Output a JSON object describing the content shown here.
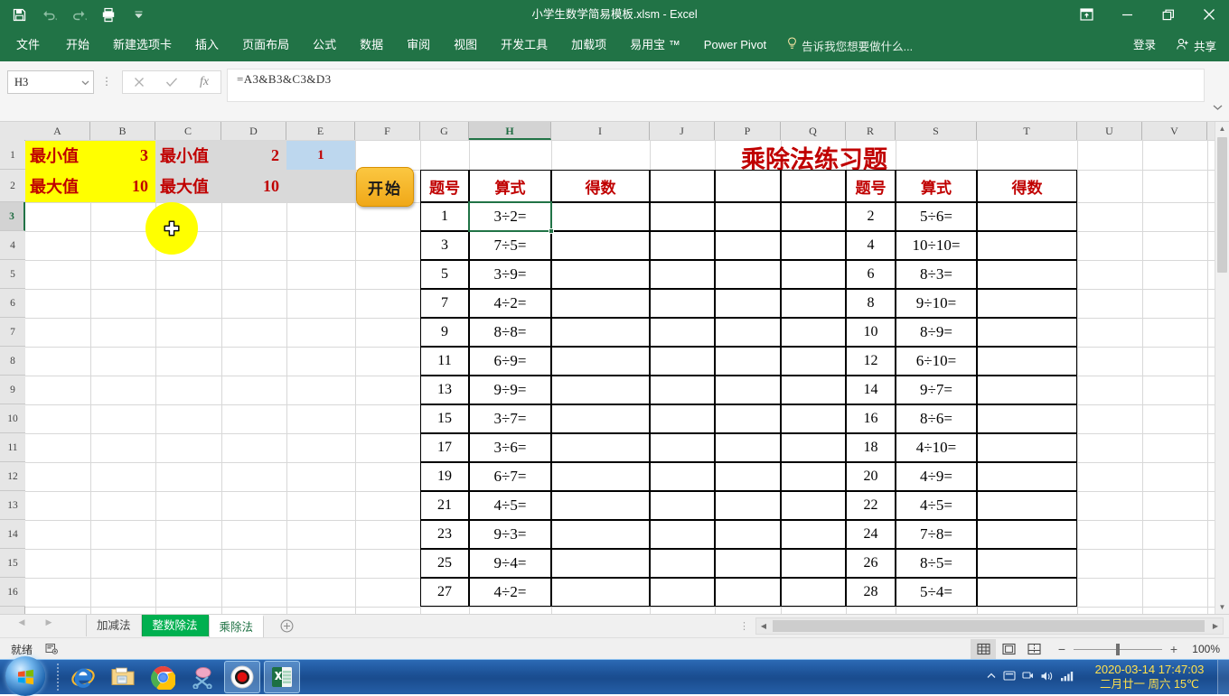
{
  "titlebar": {
    "document_title": "小学生数学简易模板.xlsm - Excel",
    "quick_access": [
      {
        "name": "save-icon",
        "label": "保存"
      },
      {
        "name": "undo-icon",
        "label": "撤销"
      },
      {
        "name": "redo-icon",
        "label": "恢复"
      },
      {
        "name": "print-preview-icon",
        "label": "打印预览和打印"
      },
      {
        "name": "customize-qat-icon",
        "label": "自定义快速访问工具栏"
      }
    ],
    "window_buttons": [
      {
        "name": "ribbon-display-options-icon",
        "label": "功能区显示选项"
      },
      {
        "name": "minimize-icon",
        "label": "最小化"
      },
      {
        "name": "restore-icon",
        "label": "向下还原"
      },
      {
        "name": "close-icon",
        "label": "关闭"
      }
    ]
  },
  "ribbon": {
    "tabs": [
      "文件",
      "开始",
      "新建选项卡",
      "插入",
      "页面布局",
      "公式",
      "数据",
      "审阅",
      "视图",
      "开发工具",
      "加载项",
      "易用宝 ™",
      "Power Pivot"
    ],
    "tell_me": "告诉我您想要做什么...",
    "sign_in": "登录",
    "share": "共享"
  },
  "formula_bar": {
    "name_box": "H3",
    "cancel_label": "取消",
    "enter_label": "输入",
    "function_label": "插入函数",
    "formula": "=A3&B3&C3&D3",
    "placeholder": ""
  },
  "grid": {
    "columns": [
      "A",
      "B",
      "C",
      "D",
      "E",
      "F",
      "G",
      "H",
      "I",
      "J",
      "P",
      "Q",
      "R",
      "S",
      "T",
      "U",
      "V"
    ],
    "selected_column": "H",
    "rows": [
      "1",
      "2",
      "3",
      "4",
      "5",
      "6",
      "7",
      "8",
      "9",
      "10",
      "11",
      "12",
      "13",
      "14",
      "15",
      "16"
    ],
    "selected_row": "3",
    "selected_cell": "H3",
    "params": [
      {
        "label": "最小值",
        "value": "3",
        "label2": "最小值",
        "value2": "2"
      },
      {
        "label": "最大值",
        "value": "10",
        "label2": "最大值",
        "value2": "10"
      }
    ],
    "counter_cell": "1",
    "start_button": "开始",
    "worksheet_title": "乘除法练习题",
    "table_headers": [
      "题号",
      "算式",
      "得数"
    ],
    "left_table": [
      {
        "no": "1",
        "expr": "3÷2=",
        "result": ""
      },
      {
        "no": "3",
        "expr": "7÷5=",
        "result": ""
      },
      {
        "no": "5",
        "expr": "3÷9=",
        "result": ""
      },
      {
        "no": "7",
        "expr": "4÷2=",
        "result": ""
      },
      {
        "no": "9",
        "expr": "8÷8=",
        "result": ""
      },
      {
        "no": "11",
        "expr": "6÷9=",
        "result": ""
      },
      {
        "no": "13",
        "expr": "9÷9=",
        "result": ""
      },
      {
        "no": "15",
        "expr": "3÷7=",
        "result": ""
      },
      {
        "no": "17",
        "expr": "3÷6=",
        "result": ""
      },
      {
        "no": "19",
        "expr": "6÷7=",
        "result": ""
      },
      {
        "no": "21",
        "expr": "4÷5=",
        "result": ""
      },
      {
        "no": "23",
        "expr": "9÷3=",
        "result": ""
      },
      {
        "no": "25",
        "expr": "9÷4=",
        "result": ""
      },
      {
        "no": "27",
        "expr": "4÷2=",
        "result": ""
      }
    ],
    "right_table": [
      {
        "no": "2",
        "expr": "5÷6=",
        "result": ""
      },
      {
        "no": "4",
        "expr": "10÷10=",
        "result": ""
      },
      {
        "no": "6",
        "expr": "8÷3=",
        "result": ""
      },
      {
        "no": "8",
        "expr": "9÷10=",
        "result": ""
      },
      {
        "no": "10",
        "expr": "8÷9=",
        "result": ""
      },
      {
        "no": "12",
        "expr": "6÷10=",
        "result": ""
      },
      {
        "no": "14",
        "expr": "9÷7=",
        "result": ""
      },
      {
        "no": "16",
        "expr": "8÷6=",
        "result": ""
      },
      {
        "no": "18",
        "expr": "4÷10=",
        "result": ""
      },
      {
        "no": "20",
        "expr": "4÷9=",
        "result": ""
      },
      {
        "no": "22",
        "expr": "4÷5=",
        "result": ""
      },
      {
        "no": "24",
        "expr": "7÷8=",
        "result": ""
      },
      {
        "no": "26",
        "expr": "8÷5=",
        "result": ""
      },
      {
        "no": "28",
        "expr": "5÷4=",
        "result": ""
      }
    ]
  },
  "sheet_bar": {
    "tabs": [
      {
        "label": "加减法",
        "state": "normal"
      },
      {
        "label": "整数除法",
        "state": "colored"
      },
      {
        "label": "乘除法",
        "state": "active"
      }
    ],
    "add_sheet_label": "新工作表"
  },
  "status_bar": {
    "status": "就绪",
    "macro_record_label": "宏录制",
    "views": [
      {
        "name": "normal-view-icon",
        "label": "普通",
        "active": true
      },
      {
        "name": "page-layout-view-icon",
        "label": "页面布局",
        "active": false
      },
      {
        "name": "page-break-view-icon",
        "label": "分页预览",
        "active": false
      }
    ],
    "zoom_out": "−",
    "zoom_in": "+",
    "zoom": "100%"
  },
  "taskbar": {
    "start_label": "开始",
    "items": [
      {
        "name": "internet-explorer-icon",
        "label": "Internet Explorer",
        "open": false
      },
      {
        "name": "file-explorer-icon",
        "label": "Windows 资源管理器",
        "open": false
      },
      {
        "name": "google-chrome-icon",
        "label": "Google Chrome",
        "open": false
      },
      {
        "name": "snipping-tool-icon",
        "label": "截图工具",
        "open": false
      },
      {
        "name": "screen-recorder-icon",
        "label": "录屏软件",
        "open": true
      },
      {
        "name": "excel-icon",
        "label": "Microsoft Excel",
        "open": true
      }
    ],
    "tray": [
      {
        "name": "tray-expand-icon"
      },
      {
        "name": "tray-app-icon"
      },
      {
        "name": "tray-network-icon"
      },
      {
        "name": "volume-icon"
      },
      {
        "name": "signal-icon"
      }
    ],
    "clock_line1": "2020-03-14  17:47:03",
    "clock_line2": "二月廿一 周六 15℃"
  },
  "colors": {
    "excel_green": "#217346",
    "accent_red": "#c00000",
    "highlight_yellow": "#ffff00",
    "param_gray": "#d9d9d9",
    "counter_blue": "#bdd7ee",
    "start_orange": "#f0a818",
    "sheet_tab_green": "#00b050",
    "cursor_halo": "#ffff00"
  }
}
